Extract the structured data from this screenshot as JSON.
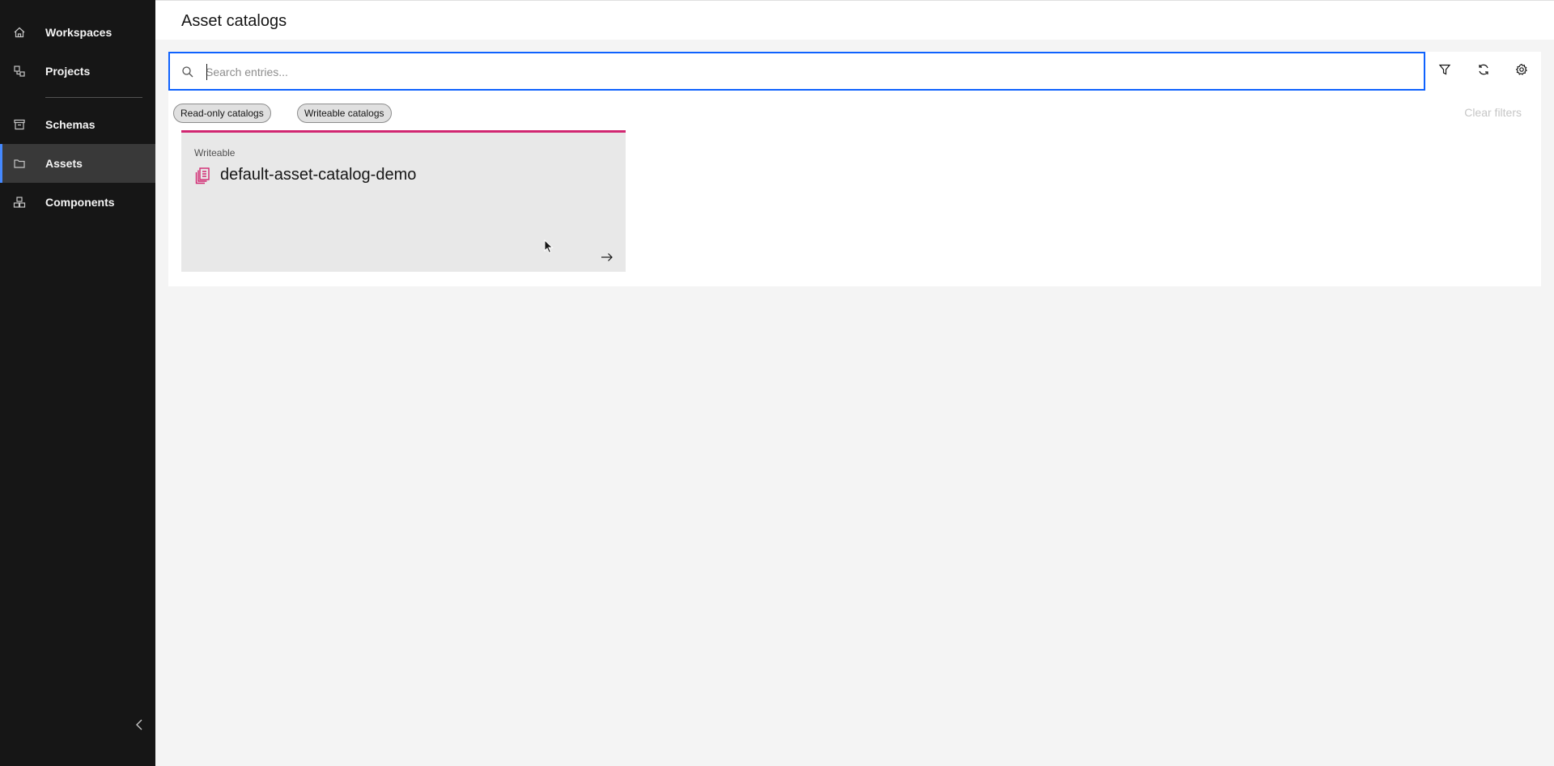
{
  "sidebar": {
    "items": [
      {
        "label": "Workspaces",
        "icon": "home-icon"
      },
      {
        "label": "Projects",
        "icon": "projects-icon"
      },
      {
        "label": "Schemas",
        "icon": "schema-icon"
      },
      {
        "label": "Assets",
        "icon": "folder-icon",
        "active": true
      },
      {
        "label": "Components",
        "icon": "components-icon"
      }
    ],
    "collapse_icon": "chevron-left-icon"
  },
  "header": {
    "title": "Asset catalogs"
  },
  "search": {
    "placeholder": "Search entries...",
    "value": ""
  },
  "toolbar": {
    "filter_icon": "filter-icon",
    "refresh_icon": "refresh-icon",
    "settings_icon": "settings-icon"
  },
  "filters": {
    "tags": [
      "Read-only catalogs",
      "Writeable catalogs"
    ],
    "clear_label": "Clear filters"
  },
  "catalogs": [
    {
      "type": "Writeable",
      "name": "default-asset-catalog-demo",
      "icon": "catalog-icon",
      "accent": "#d12771"
    }
  ],
  "colors": {
    "sidebar_bg": "#161616",
    "active_indicator": "#4589ff",
    "search_focus": "#0f62fe",
    "catalog_accent": "#d12771"
  }
}
